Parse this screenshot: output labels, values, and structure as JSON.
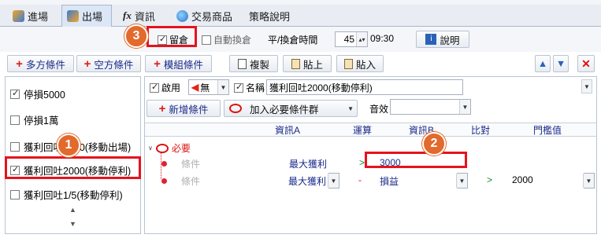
{
  "tabs": [
    {
      "label": "進場",
      "icon": "entry-icon"
    },
    {
      "label": "出場",
      "icon": "exit-icon"
    },
    {
      "label": "資訊",
      "prefix": "fx",
      "icon": "fx-icon"
    },
    {
      "label": "交易商品",
      "icon": "globe-icon"
    },
    {
      "label": "策略說明",
      "icon": ""
    }
  ],
  "toolbar": {
    "hold_label": "留倉",
    "hold_checked": true,
    "auto_rollover_label": "自動換倉",
    "auto_rollover_checked": false,
    "time_label": "平/換倉時間",
    "minutes_value": "45",
    "time_value": "09:30",
    "help_label": "說明"
  },
  "actions": {
    "long_cond": "多方條件",
    "short_cond": "空方條件",
    "module_cond": "模組條件",
    "copy": "複製",
    "paste": "貼上",
    "paste2": "貼入"
  },
  "left_list": [
    {
      "label": "停損5000",
      "checked": true
    },
    {
      "label": "停損1萬",
      "checked": false
    },
    {
      "label": "獲利回吐2000(移動出場)",
      "checked": false
    },
    {
      "label": "獲利回吐2000(移動停利)",
      "checked": true
    },
    {
      "label": "獲利回吐1/5(移動停利)",
      "checked": false
    }
  ],
  "editor": {
    "enable_label": "啟用",
    "enable_checked": true,
    "enable_combo": "無",
    "name_label": "名稱",
    "name_value": "獲利回吐2000(移動停利)",
    "add_cond": "新增條件",
    "add_required": "加入必要條件群",
    "sound_label": "音效"
  },
  "grid": {
    "headers": [
      "資訊A",
      "運算",
      "資訊B",
      "比對",
      "門檻值"
    ],
    "group_label": "必要",
    "rows": [
      {
        "name": "條件",
        "a": "最大獲利",
        "op": ">",
        "b": "3000",
        "cmp": "",
        "th": ""
      },
      {
        "name": "條件",
        "a": "最大獲利",
        "op": "-",
        "b": "損益",
        "cmp": ">",
        "th": "2000"
      }
    ]
  },
  "badges": [
    "1",
    "2",
    "3"
  ],
  "colors": {
    "highlight": "#e5131d",
    "badge": "#e26a2c",
    "link": "#1a2a8a"
  }
}
